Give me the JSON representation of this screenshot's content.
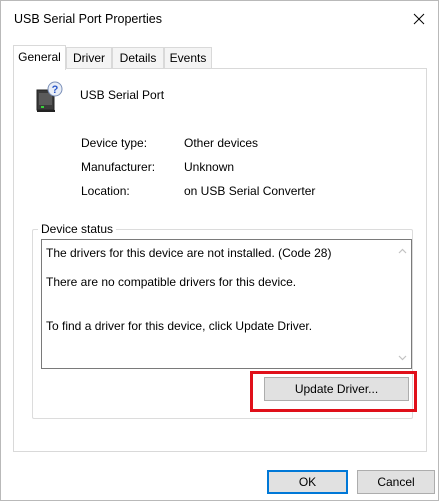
{
  "window": {
    "title": "USB Serial Port Properties"
  },
  "tabs": [
    {
      "label": "General",
      "active": true
    },
    {
      "label": "Driver",
      "active": false
    },
    {
      "label": "Details",
      "active": false
    },
    {
      "label": "Events",
      "active": false
    }
  ],
  "device": {
    "name": "USB Serial Port",
    "icon": "unknown-device-icon"
  },
  "properties": [
    {
      "label": "Device type:",
      "value": "Other devices"
    },
    {
      "label": "Manufacturer:",
      "value": "Unknown"
    },
    {
      "label": "Location:",
      "value": "on USB Serial Converter"
    }
  ],
  "device_status": {
    "label": "Device status",
    "lines": [
      "The drivers for this device are not installed. (Code 28)",
      "There are no compatible drivers for this device.",
      "To find a driver for this device, click Update Driver."
    ]
  },
  "buttons": {
    "update_driver": "Update Driver...",
    "ok": "OK",
    "cancel": "Cancel"
  },
  "colors": {
    "highlight": "#e0101a",
    "default_button_border": "#0078d7"
  }
}
